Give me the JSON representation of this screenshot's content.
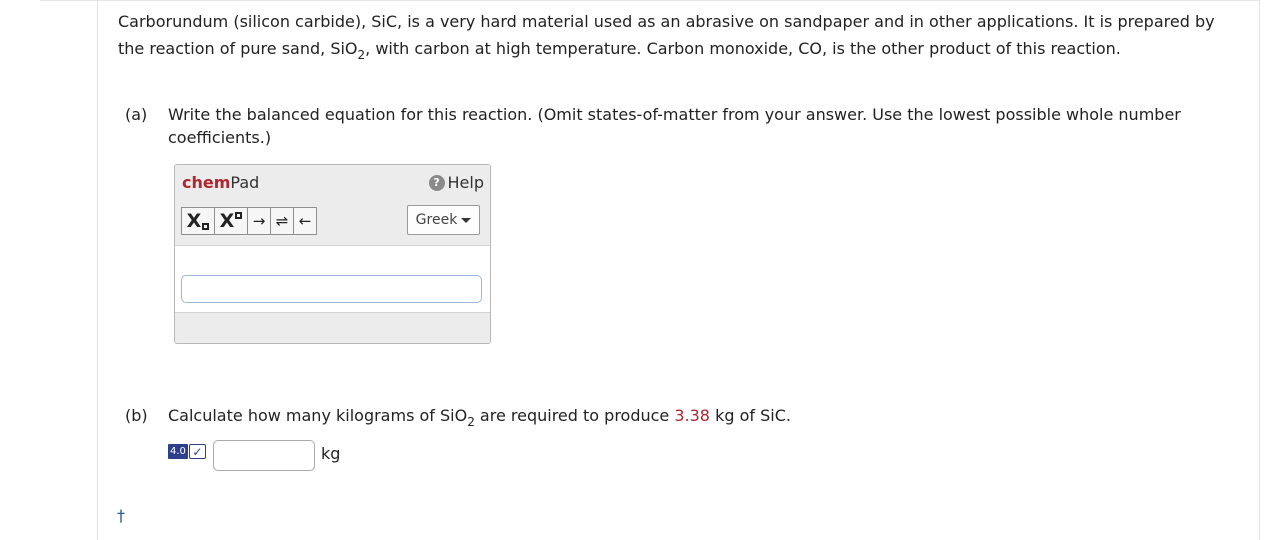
{
  "intro": {
    "text_1": "Carborundum (silicon carbide), SiC, is a very hard material used as an abrasive on sandpaper and in other applications. It is prepared by the reaction of pure sand, SiO",
    "sub_1": "2",
    "text_2": ", with carbon at high temperature. Carbon monoxide, CO, is the other product of this reaction."
  },
  "part_a": {
    "label": "(a)",
    "text": "Write the balanced equation for this reaction. (Omit states-of-matter from your answer. Use the lowest possible whole number coefficients.)"
  },
  "chempad": {
    "title_chem": "chem",
    "title_pad": "Pad",
    "help_label": "Help",
    "help_icon_glyph": "?",
    "subscript_btn": "X",
    "superscript_btn": "X",
    "arrow_right": "→",
    "arrow_equilibrium": "⇌",
    "arrow_left": "←",
    "greek_label": "Greek",
    "input_value": ""
  },
  "part_b": {
    "label": "(b)",
    "text_1": "Calculate how many kilograms of SiO",
    "sub": "2",
    "text_2": " are required to produce ",
    "value": "3.38",
    "text_3": " kg of SiC.",
    "sigfig_label": "4.0",
    "answer_value": "",
    "unit": "kg"
  },
  "footnote": {
    "dagger": "†"
  },
  "colors": {
    "accent_red": "#b0262f",
    "sigfig_blue": "#2c3e8c"
  }
}
